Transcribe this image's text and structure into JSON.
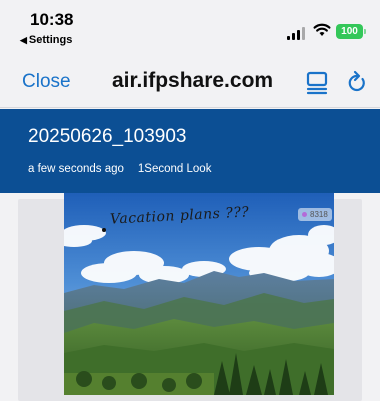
{
  "status_bar": {
    "time": "10:38",
    "back_app": "Settings",
    "battery": "100"
  },
  "nav": {
    "close_label": "Close",
    "title": "air.ifpshare.com"
  },
  "file": {
    "title": "20250626_103903",
    "age": "a few seconds ago",
    "views": "1Second Look"
  },
  "photo": {
    "caption": "Vacation plans ???",
    "badge_count": "8318"
  },
  "colors": {
    "header_bg": "#0c4f94",
    "accent": "#1a73c9",
    "battery": "#34c759"
  }
}
